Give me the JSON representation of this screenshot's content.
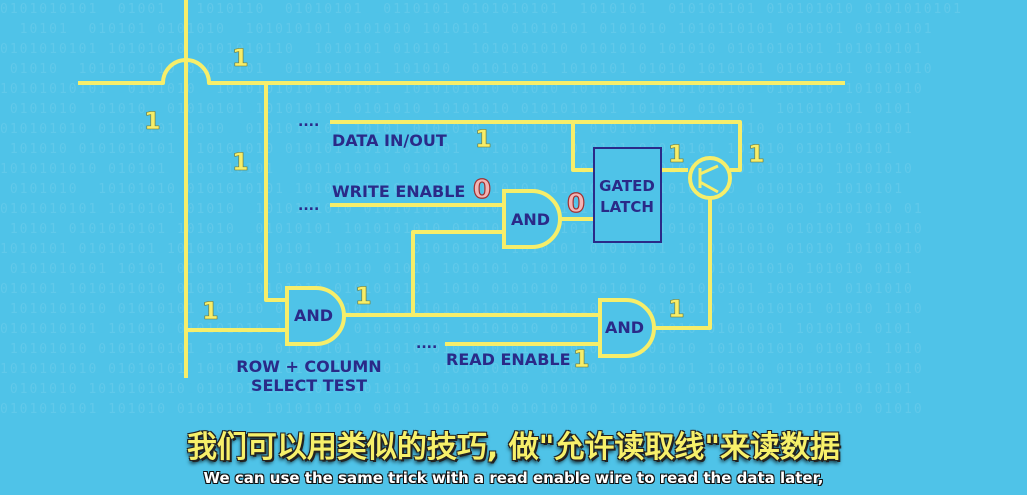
{
  "diagram": {
    "gates": {
      "and_write": "AND",
      "and_select": "AND",
      "and_read": "AND",
      "latch_line1": "GATED",
      "latch_line2": "LATCH"
    },
    "labels": {
      "data_in_out": "DATA IN/OUT",
      "write_enable": "WRITE ENABLE",
      "read_enable": "READ ENABLE",
      "select_line1": "ROW + COLUMN",
      "select_line2": "SELECT TEST",
      "dots": "...."
    },
    "wire_values": {
      "vertical_top": "1",
      "horizontal_left": "1",
      "vertical_mid": "1",
      "data_in_out": "1",
      "latch_output": "1",
      "transistor_output": "1",
      "write_enable": "0",
      "write_and_output": "0",
      "select_input": "1",
      "select_and_output": "1",
      "read_and_output": "1",
      "read_enable": "1"
    },
    "colors": {
      "wire": "#f6ee6a",
      "gate_fill": "#4fc3e8",
      "text": "#2a2a88",
      "zero": "#f3b5b5"
    }
  },
  "subtitles": {
    "chinese": "我们可以用类似的技巧, 做\"允许读取线\"来读数据",
    "english": "We can use the same trick with a read enable wire to read the data later,"
  }
}
